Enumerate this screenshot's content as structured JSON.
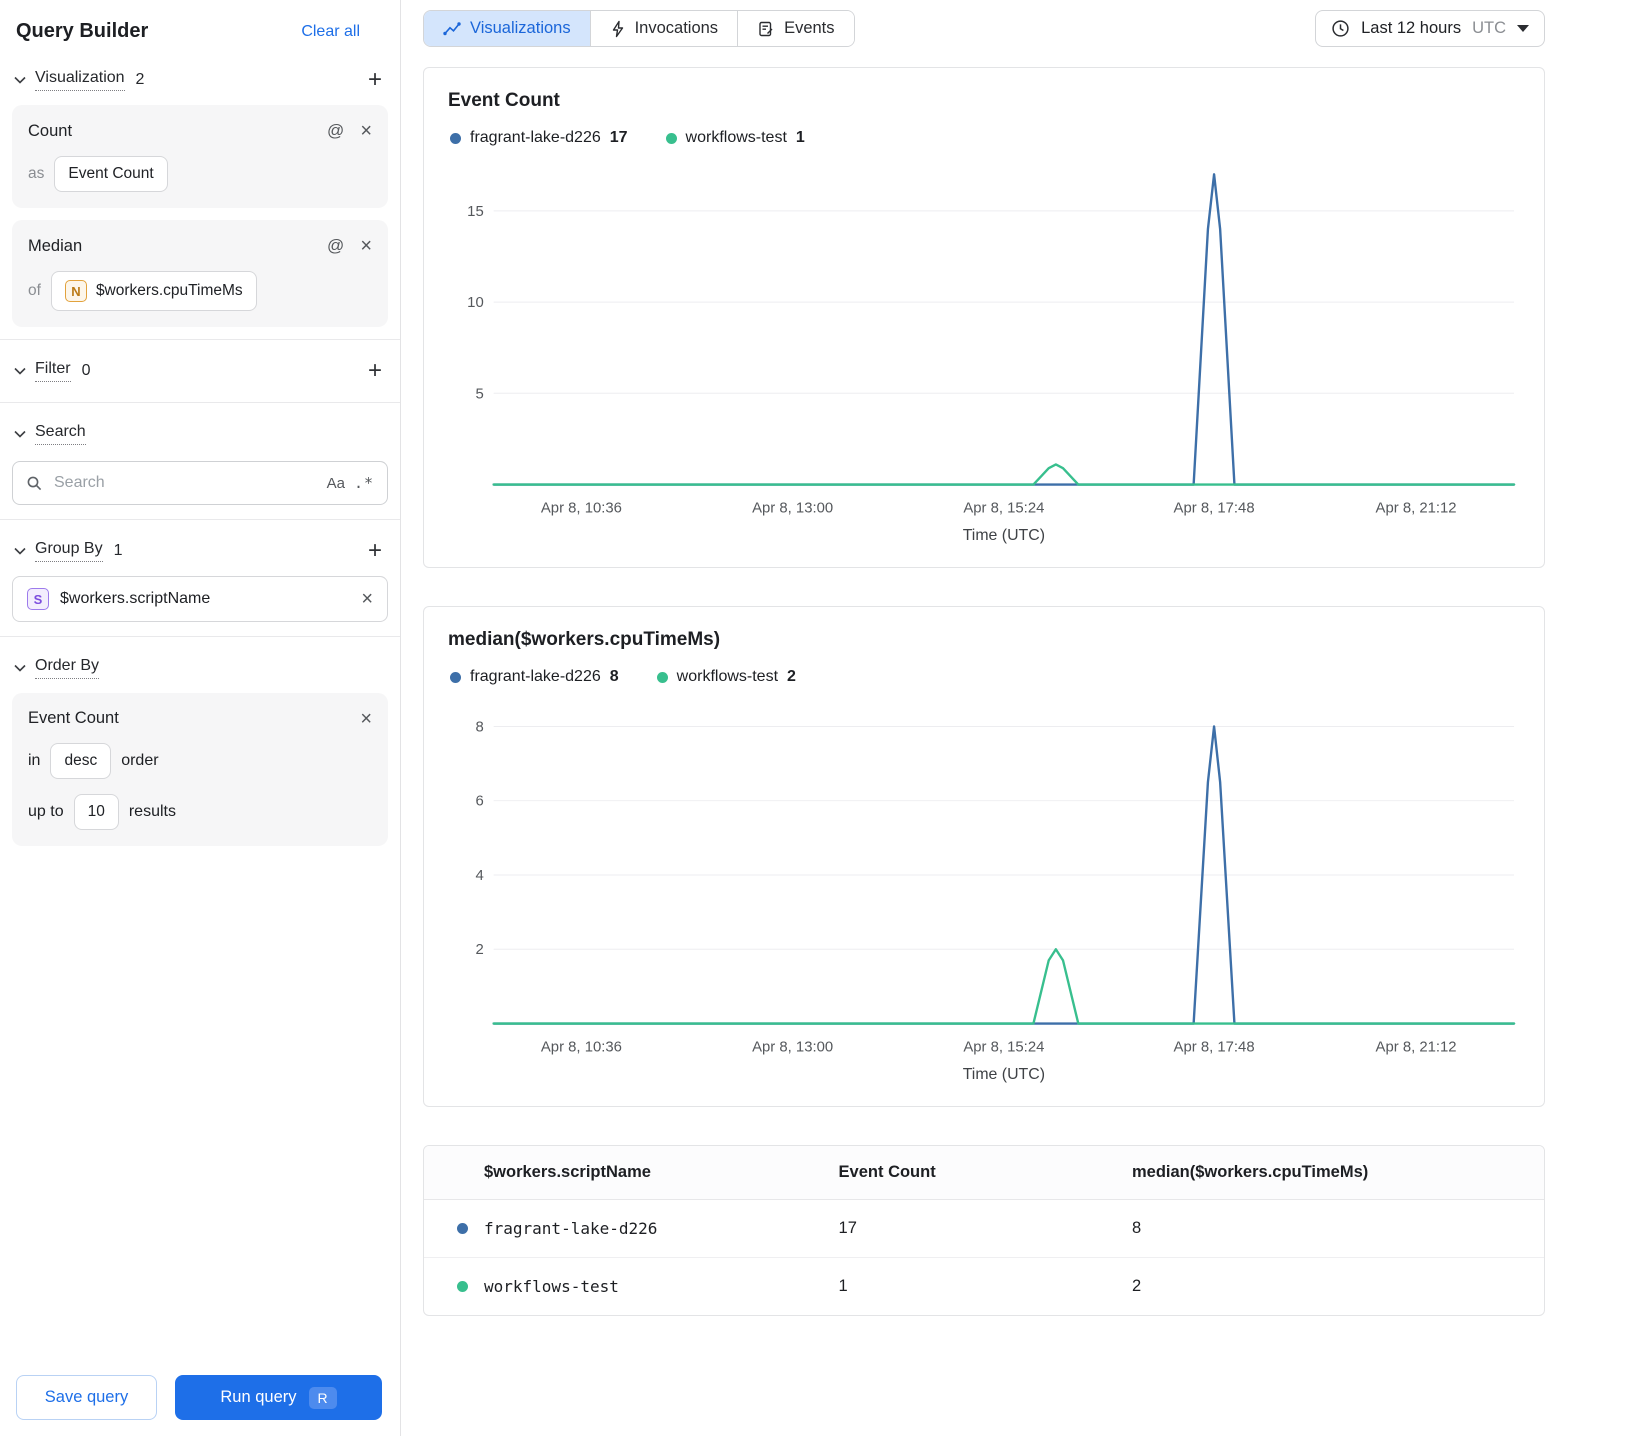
{
  "colors": {
    "accent_blue": "#1e6fe8",
    "series_blue": "#3d6fa8",
    "series_green": "#38bf8e",
    "tab_active_bg": "#d4e5fc"
  },
  "sidebar": {
    "title": "Query Builder",
    "clear_all_label": "Clear all",
    "sections": {
      "visualization": {
        "label": "Visualization",
        "count": "2"
      },
      "filter": {
        "label": "Filter",
        "count": "0"
      },
      "search": {
        "label": "Search"
      },
      "group_by": {
        "label": "Group By",
        "count": "1"
      },
      "order_by": {
        "label": "Order By"
      }
    },
    "count_card": {
      "title": "Count",
      "as": "as",
      "value": "Event Count"
    },
    "median_card": {
      "title": "Median",
      "of": "of",
      "type_badge": "N",
      "field": "$workers.cpuTimeMs"
    },
    "search_input": {
      "placeholder": "Search",
      "match_case": "Aa",
      "regex": ".*"
    },
    "group_by_item": {
      "type_badge": "S",
      "value": "$workers.scriptName"
    },
    "order_card": {
      "title": "Event Count",
      "in_word": "in",
      "direction": "desc",
      "order_word": "order",
      "up_to_word": "up to",
      "limit": "10",
      "results_word": "results"
    },
    "save_button": "Save query",
    "run_button": "Run query",
    "run_shortcut": "R"
  },
  "topbar": {
    "tabs": [
      {
        "label": "Visualizations"
      },
      {
        "label": "Invocations"
      },
      {
        "label": "Events"
      }
    ],
    "time_range": {
      "label": "Last 12 hours",
      "zone": "UTC"
    }
  },
  "chart_data": [
    {
      "type": "line",
      "title": "Event Count",
      "xlabel": "Time (UTC)",
      "ylim": [
        0,
        17.3
      ],
      "yticks": [
        5,
        10,
        15
      ],
      "x_ticks": [
        {
          "label": "Apr 8, 10:36",
          "pos": 0.086
        },
        {
          "label": "Apr 8, 13:00",
          "pos": 0.293
        },
        {
          "label": "Apr 8, 15:24",
          "pos": 0.5
        },
        {
          "label": "Apr 8, 17:48",
          "pos": 0.706
        },
        {
          "label": "Apr 8, 21:12",
          "pos": 0.904
        }
      ],
      "series": [
        {
          "name": "fragrant-lake-d226",
          "total": "17",
          "color": "#3d6fa8",
          "peak_time": "Apr 8, 17:48",
          "peak_value": 17,
          "points": [
            [
              0,
              0
            ],
            [
              0.686,
              0
            ],
            [
              0.7,
              14
            ],
            [
              0.706,
              17
            ],
            [
              0.712,
              14
            ],
            [
              0.726,
              0
            ],
            [
              1,
              0
            ]
          ]
        },
        {
          "name": "workflows-test",
          "total": "1",
          "color": "#38bf8e",
          "peak_time": "Apr 8, 15:24",
          "peak_value": 1,
          "points": [
            [
              0,
              0
            ],
            [
              0.529,
              0
            ],
            [
              0.544,
              0.9
            ],
            [
              0.551,
              1.1
            ],
            [
              0.558,
              0.9
            ],
            [
              0.573,
              0
            ],
            [
              1,
              0
            ]
          ]
        }
      ]
    },
    {
      "type": "line",
      "title": "median($workers.cpuTimeMs)",
      "xlabel": "Time (UTC)",
      "ylim": [
        0,
        8.5
      ],
      "yticks": [
        2,
        4,
        6,
        8
      ],
      "x_ticks": [
        {
          "label": "Apr 8, 10:36",
          "pos": 0.086
        },
        {
          "label": "Apr 8, 13:00",
          "pos": 0.293
        },
        {
          "label": "Apr 8, 15:24",
          "pos": 0.5
        },
        {
          "label": "Apr 8, 17:48",
          "pos": 0.706
        },
        {
          "label": "Apr 8, 21:12",
          "pos": 0.904
        }
      ],
      "series": [
        {
          "name": "fragrant-lake-d226",
          "total": "8",
          "color": "#3d6fa8",
          "peak_time": "Apr 8, 17:48",
          "peak_value": 8,
          "points": [
            [
              0,
              0
            ],
            [
              0.686,
              0
            ],
            [
              0.7,
              6.5
            ],
            [
              0.706,
              8
            ],
            [
              0.712,
              6.5
            ],
            [
              0.726,
              0
            ],
            [
              1,
              0
            ]
          ]
        },
        {
          "name": "workflows-test",
          "total": "2",
          "color": "#38bf8e",
          "peak_time": "Apr 8, 15:24",
          "peak_value": 2,
          "points": [
            [
              0,
              0
            ],
            [
              0.529,
              0
            ],
            [
              0.544,
              1.7
            ],
            [
              0.551,
              2
            ],
            [
              0.558,
              1.7
            ],
            [
              0.573,
              0
            ],
            [
              1,
              0
            ]
          ]
        }
      ]
    }
  ],
  "table": {
    "headers": [
      "$workers.scriptName",
      "Event Count",
      "median($workers.cpuTimeMs)"
    ],
    "rows": [
      {
        "name": "fragrant-lake-d226",
        "event_count": "17",
        "median": "8"
      },
      {
        "name": "workflows-test",
        "event_count": "1",
        "median": "2"
      }
    ]
  }
}
